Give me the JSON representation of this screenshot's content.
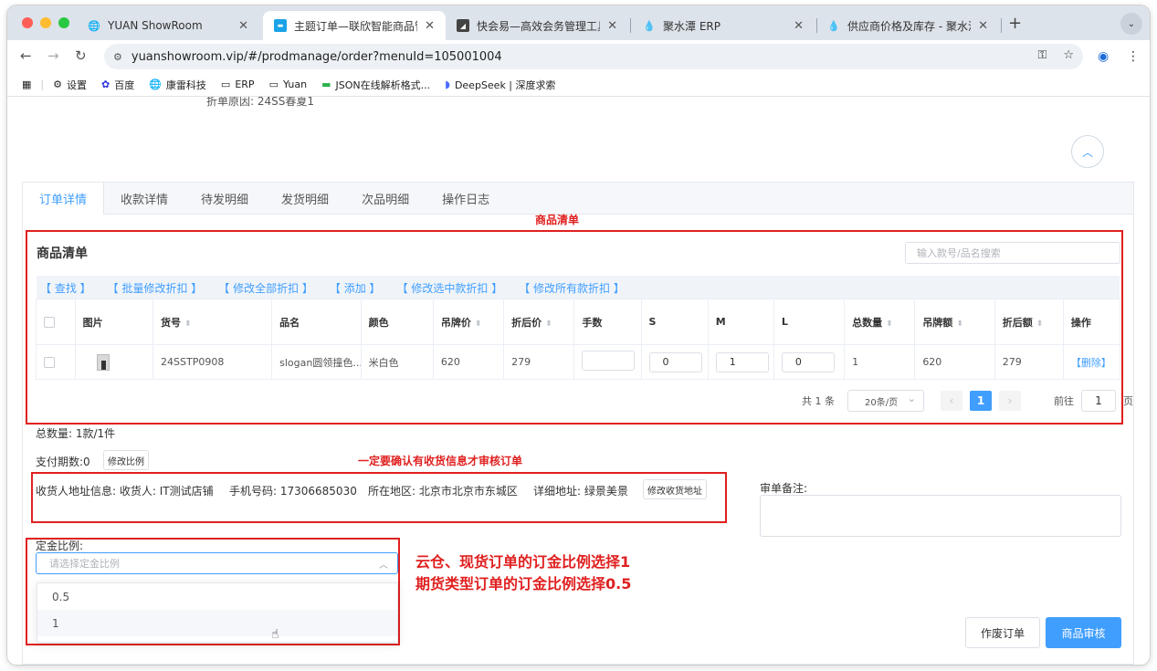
{
  "browser": {
    "tabs": [
      {
        "title": "YUAN ShowRoom",
        "icon": "globe-icon"
      },
      {
        "title": "主题订单—联欣智能商品管理系统",
        "icon": "site-icon"
      },
      {
        "title": "快会易—高效会务管理工具",
        "icon": "site-icon"
      },
      {
        "title": "聚水潭 ERP",
        "icon": "drop-icon"
      },
      {
        "title": "供应商价格及库存 - 聚水潭ERP",
        "icon": "drop-icon"
      }
    ],
    "url": "yuanshowroom.vip/#/prodmanage/order?menuId=105001004",
    "bookmarks": [
      "设置",
      "百度",
      "康雷科技",
      "ERP",
      "Yuan",
      "JSON在线解析格式...",
      "DeepSeek | 深度求索"
    ]
  },
  "page": {
    "cut_text": "折单原因: 24SS春夏1",
    "tabs": [
      "订单详情",
      "收款详情",
      "待发明细",
      "发货明细",
      "次品明细",
      "操作日志"
    ],
    "annotation_top": "商品清单",
    "section_title": "商品清单",
    "search_placeholder": "输入款号/品名搜索",
    "actions": [
      "【 查找 】",
      "【 批量修改折扣 】",
      "【 修改全部折扣 】",
      "【 添加 】",
      "【 修改选中款折扣 】",
      "【 修改所有款折扣 】"
    ],
    "columns": [
      "图片",
      "货号",
      "品名",
      "颜色",
      "吊牌价",
      "折后价",
      "手数",
      "S",
      "M",
      "L",
      "总数量",
      "吊牌额",
      "折后额",
      "操作"
    ],
    "row": {
      "sku": "24SSTP0908",
      "name": "slogan圆领撞色...",
      "color": "米白色",
      "tag_price": "620",
      "disc_price": "279",
      "hands": "",
      "s": "0",
      "m": "1",
      "l": "0",
      "total": "1",
      "tag_amount": "620",
      "disc_amount": "279",
      "op": "【删除】"
    },
    "pager": {
      "total": "共 1 条",
      "size": "20条/页",
      "prev": "‹",
      "current": "1",
      "next": "›",
      "goto_label": "前往",
      "goto_value": "1",
      "page_label": "页"
    },
    "total_qty": "总数量: 1款/1件",
    "pay_periods": "支付期数:0",
    "edit_ratio_btn": "修改比例",
    "annotation_mid": "一定要确认有收货信息才审核订单",
    "address": {
      "receiver": "收货人地址信息: 收货人: IT测试店铺",
      "phone": "手机号码: 17306685030",
      "region": "所在地区: 北京市北京市东城区",
      "detail": "详细地址: 绿景美景",
      "edit_btn": "修改收货地址"
    },
    "remark_label": "审单备注:",
    "deposit_label": "定金比例:",
    "deposit_placeholder": "请选择定金比例",
    "deposit_options": [
      "0.5",
      "1"
    ],
    "annotation_bottom_1": "云仓、现货订单的订金比例选择1",
    "annotation_bottom_2": "期货类型订单的订金比例选择0.5",
    "void_btn": "作废订单",
    "audit_btn": "商品审核"
  },
  "colors": {
    "accent": "#409eff",
    "annotation": "#e02020"
  }
}
